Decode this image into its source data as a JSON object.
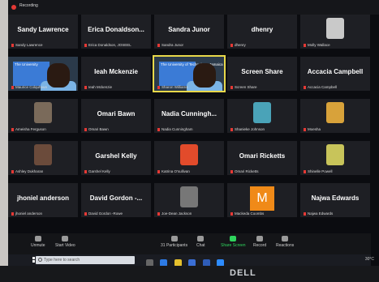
{
  "window": {
    "recording_label": "Recording"
  },
  "tiles": [
    {
      "id": "t01",
      "name": "Sandy Lawrence",
      "sub": "Sandy Lawrence",
      "kind": "name"
    },
    {
      "id": "t02",
      "name": "Erica Donaldson...",
      "sub": "Erica Donaldson, JOSEEL",
      "kind": "name"
    },
    {
      "id": "t03",
      "name": "Sandra Junor",
      "sub": "Sandra Junor",
      "kind": "name"
    },
    {
      "id": "t04",
      "name": "dhenry",
      "sub": "dhenry",
      "kind": "name"
    },
    {
      "id": "t05",
      "name": "",
      "sub": "Molly Wallace",
      "kind": "photo",
      "color": "#c9c9c9"
    },
    {
      "id": "t06",
      "name": "",
      "sub": "Maurice Colquhoun",
      "kind": "video",
      "slide": "The University",
      "active": false
    },
    {
      "id": "t07",
      "name": "Ieah Mckenzie",
      "sub": "Ieah Mckenzie",
      "kind": "name"
    },
    {
      "id": "t08",
      "name": "",
      "sub": "Sharon Williams",
      "kind": "video",
      "slide": "The University of Technology, Jamaica",
      "active": true
    },
    {
      "id": "t09",
      "name": "Screen Share",
      "sub": "Screen Share",
      "kind": "name"
    },
    {
      "id": "t10",
      "name": "Accacia Campbell",
      "sub": "Accacia Campbell",
      "kind": "name"
    },
    {
      "id": "t11",
      "name": "",
      "sub": "Ameisha Ferguson",
      "kind": "photo",
      "color": "#7a6a5a"
    },
    {
      "id": "t12",
      "name": "Omari Bawn",
      "sub": "Omari Bawn",
      "kind": "name"
    },
    {
      "id": "t13",
      "name": "Nadia Cunningh...",
      "sub": "Nadia Cunningham",
      "kind": "name"
    },
    {
      "id": "t14",
      "name": "",
      "sub": "Shanieke Johnson",
      "kind": "photo",
      "color": "#4aa3b8"
    },
    {
      "id": "t15",
      "name": "",
      "sub": "Moesha",
      "kind": "photo",
      "color": "#d8a23a"
    },
    {
      "id": "t16",
      "name": "",
      "sub": "Ashley Dukharan",
      "kind": "photo",
      "color": "#6b4b3b"
    },
    {
      "id": "t17",
      "name": "Garshel Kelly",
      "sub": "Garshel Kelly",
      "kind": "name"
    },
    {
      "id": "t18",
      "name": "",
      "sub": "Katrina O'sullivan",
      "kind": "photo",
      "color": "#e24b2b"
    },
    {
      "id": "t19",
      "name": "Omari Ricketts",
      "sub": "Omari Ricketts",
      "kind": "name"
    },
    {
      "id": "t20",
      "name": "",
      "sub": "Shinelle Powell",
      "kind": "photo",
      "color": "#c8c45a"
    },
    {
      "id": "t21",
      "name": "jhoniel anderson",
      "sub": "jhoniel anderson",
      "kind": "name"
    },
    {
      "id": "t22",
      "name": "David Gordon -...",
      "sub": "David Gordon -Rowe",
      "kind": "name"
    },
    {
      "id": "t23",
      "name": "",
      "sub": "Joe-Dean Jackson",
      "kind": "photo",
      "color": "#777"
    },
    {
      "id": "t24",
      "name": "",
      "sub": "Mackeda Coombs",
      "kind": "letter",
      "letter": "M"
    },
    {
      "id": "t25",
      "name": "Najwa Edwards",
      "sub": "Najwa Edwards",
      "kind": "name"
    }
  ],
  "toolbar": {
    "unmute": "Unmute",
    "start_video": "Start Video",
    "participants": "Participants",
    "participants_count": "31",
    "chat": "Chat",
    "share_screen": "Share Screen",
    "record": "Record",
    "reactions": "Reactions"
  },
  "taskbar": {
    "search_placeholder": "Type here to search",
    "tray_text": "30°C"
  },
  "brand": "DELL",
  "colors": {
    "accent_green": "#2fd45d",
    "highlight": "#e8d84a",
    "mic_red": "#e53935",
    "m_tile": "#f08a18"
  }
}
